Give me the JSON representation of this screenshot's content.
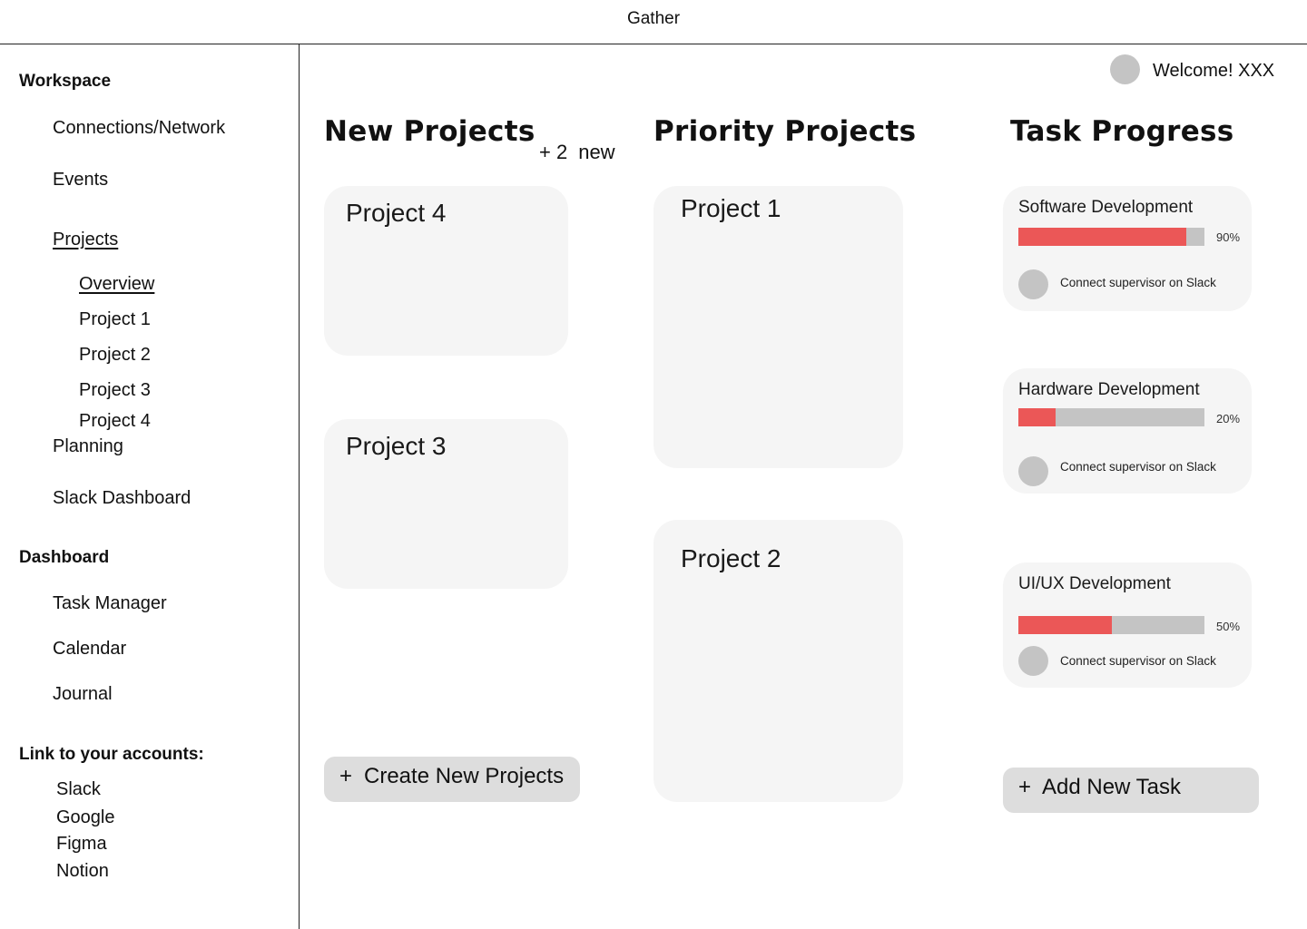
{
  "app": {
    "title": "Gather"
  },
  "sidebar": {
    "workspace_heading": "Workspace",
    "workspace_items": {
      "connections": "Connections/Network",
      "events": "Events",
      "projects": "Projects",
      "planning": "Planning",
      "slack_dashboard": "Slack Dashboard"
    },
    "project_subitems": [
      "Overview",
      "Project 1",
      "Project 2",
      "Project 3",
      "Project 4"
    ],
    "dashboard_heading": "Dashboard",
    "dashboard_items": [
      "Task Manager",
      "Calendar",
      "Journal"
    ],
    "accounts_heading": "Link to your accounts:",
    "accounts": [
      "Slack",
      "Google",
      "Figma",
      "Notion"
    ]
  },
  "header": {
    "welcome": "Welcome! XXX"
  },
  "new_projects": {
    "heading": "New Projects",
    "count_prefix": "+ 2",
    "count_suffix": "new",
    "cards": [
      "Project 4",
      "Project 3"
    ],
    "create_plus": "+",
    "create_label": "Create New Projects"
  },
  "priority_projects": {
    "heading": "Priority Projects",
    "cards": [
      "Project 1",
      "Project 2"
    ]
  },
  "task_progress": {
    "heading": "Task Progress",
    "tasks": [
      {
        "title": "Software Development",
        "percent_label": "90%",
        "progress": 0.9,
        "link": "Connect supervisor on Slack"
      },
      {
        "title": "Hardware Development",
        "percent_label": "20%",
        "progress": 0.2,
        "link": "Connect supervisor on Slack"
      },
      {
        "title": "UI/UX Development",
        "percent_label": "50%",
        "progress": 0.5,
        "link": "Connect supervisor on Slack"
      }
    ],
    "add_plus": "+",
    "add_label": "Add New Task"
  },
  "colors": {
    "progress_fill": "#eb5757",
    "progress_track": "#c4c4c4",
    "card_bg": "#f5f5f5",
    "button_bg": "#dddddd"
  }
}
